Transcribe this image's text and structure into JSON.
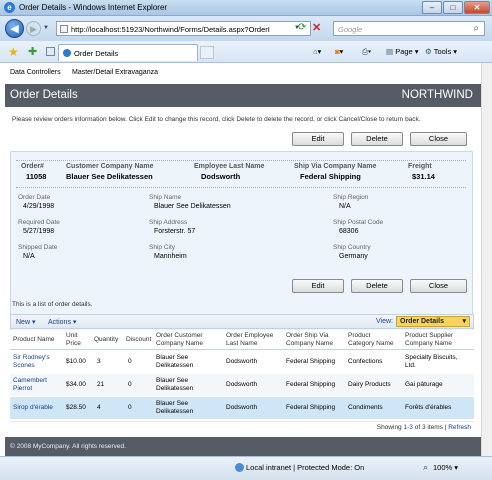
{
  "window": {
    "title": "Order Details - Windows Internet Explorer",
    "minimize": "–",
    "maximize": "□",
    "close": "✕"
  },
  "address_bar": {
    "url": "http://localhost:51923/Northwind/Forms/Details.aspx?OrderI",
    "search_placeholder": "Google"
  },
  "browser_tab": {
    "label": "Order Details"
  },
  "command_bar": {
    "page": "Page",
    "tools": "Tools"
  },
  "menu": {
    "items": [
      "Data Controllers",
      "Master/Detail Extravaganza"
    ]
  },
  "header": {
    "title": "Order Details",
    "brand": "NORTHWIND"
  },
  "instructions": "Please review orders information below. Click Edit to change this record, click Delete to delete the record, or click Cancel/Close to return back.",
  "buttons": {
    "edit": "Edit",
    "delete": "Delete",
    "close": "Close"
  },
  "order_summary": {
    "labels": [
      "Order#",
      "Customer Company Name",
      "Employee Last Name",
      "Ship Via Company Name",
      "Freight"
    ],
    "values": [
      "11058",
      "Blauer See Delikatessen",
      "Dodsworth",
      "Federal Shipping",
      "$31.14"
    ]
  },
  "order_fields": {
    "order_date": {
      "label": "Order Date",
      "value": "4/29/1998"
    },
    "required_date": {
      "label": "Required Date",
      "value": "5/27/1998"
    },
    "shipped_date": {
      "label": "Shipped Date",
      "value": "N/A"
    },
    "ship_name": {
      "label": "Ship Name",
      "value": "Blauer See Delikatessen"
    },
    "ship_address": {
      "label": "Ship Address",
      "value": "Forsterstr. 57"
    },
    "ship_city": {
      "label": "Ship City",
      "value": "Mannheim"
    },
    "ship_region": {
      "label": "Ship Region",
      "value": "N/A"
    },
    "ship_postal_code": {
      "label": "Ship Postal Code",
      "value": "68306"
    },
    "ship_country": {
      "label": "Ship Country",
      "value": "Germany"
    }
  },
  "details_note": "This is a list of order details.",
  "grid_toolbar": {
    "new": "New",
    "actions": "Actions",
    "view_label": "View:",
    "view_selected": "Order Details"
  },
  "grid": {
    "columns": [
      {
        "l1": "Product Name",
        "l2": ""
      },
      {
        "l1": "Unit",
        "l2": "Price"
      },
      {
        "l1": "Quantity",
        "l2": ""
      },
      {
        "l1": "Discount",
        "l2": ""
      },
      {
        "l1": "Order Customer",
        "l2": "Company Name"
      },
      {
        "l1": "Order Employee",
        "l2": "Last Name"
      },
      {
        "l1": "Order Ship Via",
        "l2": "Company Name"
      },
      {
        "l1": "Product",
        "l2": "Category Name"
      },
      {
        "l1": "Product Supplier",
        "l2": "Company Name"
      }
    ],
    "rows": [
      {
        "product_l1": "Sir Rodney's",
        "product_l2": "Scones",
        "price": "$10.00",
        "qty": "3",
        "discount": "0",
        "cust_l1": "Blauer See",
        "cust_l2": "Delikatessen",
        "employee": "Dodsworth",
        "shipvia": "Federal Shipping",
        "category": "Confections",
        "supplier_l1": "Specialty Biscuits,",
        "supplier_l2": "Ltd."
      },
      {
        "product_l1": "Camembert",
        "product_l2": "Pierrot",
        "price": "$34.00",
        "qty": "21",
        "discount": "0",
        "cust_l1": "Blauer See",
        "cust_l2": "Delikatessen",
        "employee": "Dodsworth",
        "shipvia": "Federal Shipping",
        "category": "Dairy Products",
        "supplier_l1": "Gai pâturage",
        "supplier_l2": ""
      },
      {
        "product_l1": "Sirop d'érable",
        "product_l2": "",
        "price": "$28.50",
        "qty": "4",
        "discount": "0",
        "cust_l1": "Blauer See",
        "cust_l2": "Delikatessen",
        "employee": "Dodsworth",
        "shipvia": "Federal Shipping",
        "category": "Condiments",
        "supplier_l1": "Forêts d'érables",
        "supplier_l2": ""
      }
    ]
  },
  "pager": {
    "showing": "Showing",
    "range": "1-3",
    "of": "of",
    "total": "3",
    "items": "items",
    "separator": "|",
    "refresh": "Refresh"
  },
  "footer": "© 2008 MyCompany. All rights reserved.",
  "status_bar": {
    "zone": "Local intranet | Protected Mode: On",
    "zoom": "100%"
  },
  "colors": {
    "header_bg": "#555c66",
    "panel_bg": "#eef4fb",
    "view_selector": "#fbd35b",
    "selected_row": "#cfe6f7",
    "link": "#1a3f8a"
  }
}
